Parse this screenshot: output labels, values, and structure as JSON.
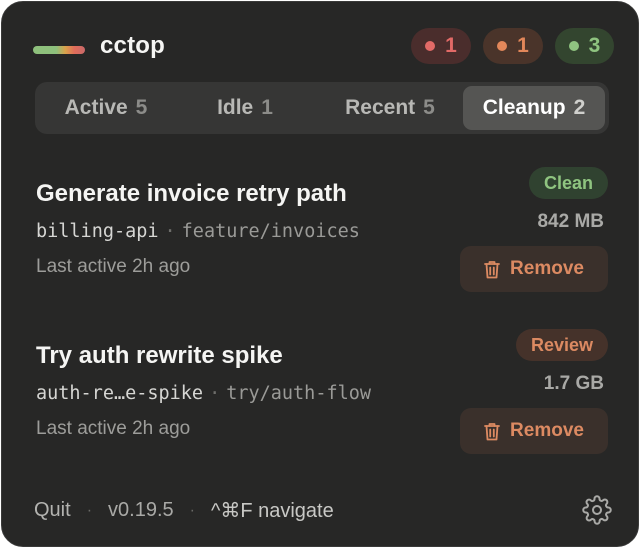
{
  "app": {
    "title": "cctop"
  },
  "status_pills": [
    {
      "count": "1",
      "color": "#e26a67"
    },
    {
      "count": "1",
      "color": "#e2875a"
    },
    {
      "count": "3",
      "color": "#8fc480"
    }
  ],
  "tabs": [
    {
      "label": "Active",
      "count": "5",
      "selected": false
    },
    {
      "label": "Idle",
      "count": "1",
      "selected": false
    },
    {
      "label": "Recent",
      "count": "5",
      "selected": false
    },
    {
      "label": "Cleanup",
      "count": "2",
      "selected": true
    }
  ],
  "items": [
    {
      "title": "Generate invoice retry path",
      "repo": "billing-api",
      "separator": "·",
      "branch": "feature/invoices",
      "last_active": "Last active 2h ago",
      "status": "Clean",
      "size": "842 MB",
      "action_label": "Remove"
    },
    {
      "title": "Try auth rewrite spike",
      "repo": "auth-re…e-spike",
      "separator": "·",
      "branch": "try/auth-flow",
      "last_active": "Last active 2h ago",
      "status": "Review",
      "size": "1.7 GB",
      "action_label": "Remove"
    }
  ],
  "footer": {
    "quit_label": "Quit",
    "separator": "·",
    "version": "v0.19.5",
    "hint": "^⌘F navigate"
  },
  "icons": {
    "trash": "trash-icon",
    "settings": "gear-icon"
  },
  "colors": {
    "background": "#272726",
    "accent_green": "#8fc480",
    "accent_orange": "#dc8a62",
    "accent_red": "#e26a67"
  }
}
